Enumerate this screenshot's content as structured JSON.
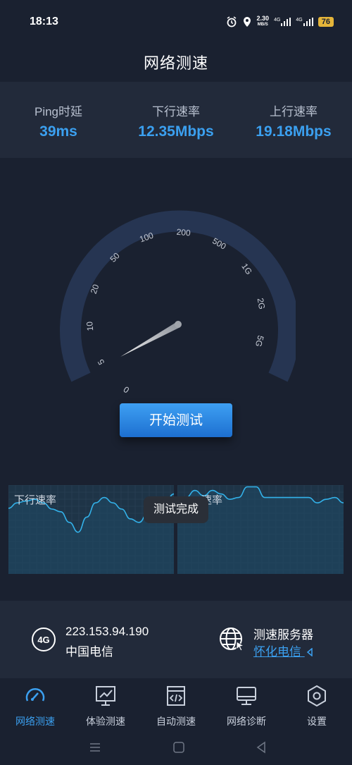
{
  "status_bar": {
    "time": "18:13",
    "net_speed_top": "2.30",
    "net_speed_unit": "MB/S",
    "signal1": "4G",
    "signal2": "4G",
    "battery": "76"
  },
  "page_title": "网络测速",
  "stats": [
    {
      "label": "Ping时延",
      "value": "39ms"
    },
    {
      "label": "下行速率",
      "value": "12.35Mbps"
    },
    {
      "label": "上行速率",
      "value": "19.18Mbps"
    }
  ],
  "gauge": {
    "tick_labels": [
      "0",
      "5",
      "10",
      "20",
      "50",
      "100",
      "200",
      "500",
      "1G",
      "2G",
      "5G"
    ],
    "colors": {
      "arc": "#263552",
      "needle": "#e8e8e8"
    }
  },
  "start_button": "开始测试",
  "graphs": {
    "download_label": "下行速率",
    "upload_label": "速率",
    "line_color": "#33b2ea",
    "fill_color": "#1f4a66",
    "download_levels": [
      0.74,
      0.8,
      0.82,
      0.84,
      0.8,
      0.73,
      0.7,
      0.58,
      0.47,
      0.64,
      0.8,
      0.86,
      0.8,
      0.73,
      0.62,
      0.58,
      0.68,
      0.78,
      0.8,
      0.9
    ],
    "upload_levels": [
      0.75,
      0.86,
      0.94,
      0.88,
      0.94,
      0.9,
      0.84,
      0.86,
      0.98,
      0.98,
      0.86,
      0.86,
      0.86,
      0.86,
      0.86,
      0.86,
      0.8,
      0.84,
      0.86,
      0.8
    ]
  },
  "toast": "测试完成",
  "network_info": {
    "badge": "4G",
    "ip": "223.153.94.190",
    "isp": "中国电信"
  },
  "server_info": {
    "title": "测速服务器",
    "name": "怀化电信"
  },
  "nav": [
    {
      "label": "网络测速",
      "icon": "speedometer-icon",
      "active": true
    },
    {
      "label": "体验测速",
      "icon": "monitor-chart-icon",
      "active": false
    },
    {
      "label": "自动测速",
      "icon": "code-window-icon",
      "active": false
    },
    {
      "label": "网络诊断",
      "icon": "desktop-icon",
      "active": false
    },
    {
      "label": "设置",
      "icon": "gear-hexagon-icon",
      "active": false
    }
  ],
  "colors": {
    "accent": "#3ba0f0",
    "background": "#1a2130",
    "panel": "#222a3a"
  }
}
